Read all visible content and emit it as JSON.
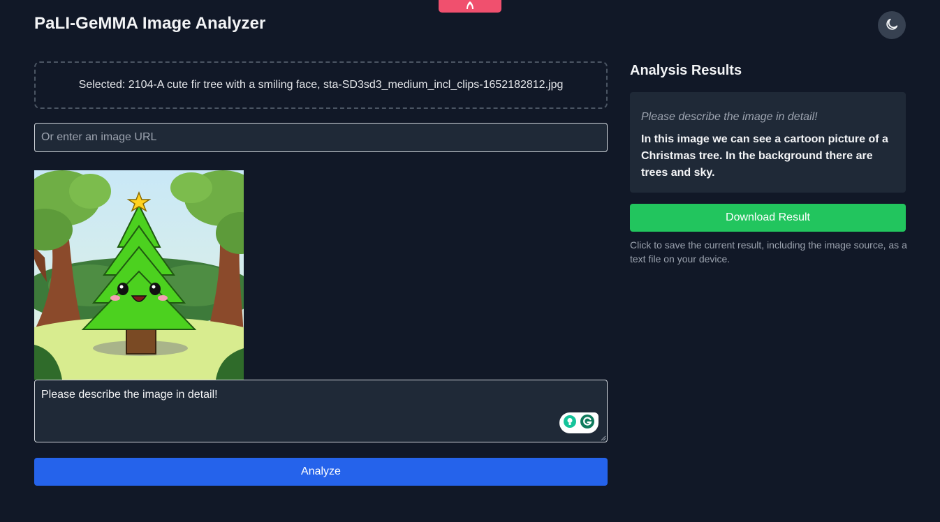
{
  "app": {
    "title": "PaLI-GeMMA Image Analyzer"
  },
  "icons": {
    "theme_toggle": "moon-icon",
    "top_tab": "flame-icon",
    "grammarly": "grammarly-icon"
  },
  "upload": {
    "selected_text": "Selected: 2104-A cute fir tree with a smiling face, sta-SD3sd3_medium_incl_clips-1652182812.jpg"
  },
  "url_input": {
    "placeholder": "Or enter an image URL",
    "value": ""
  },
  "prompt": {
    "value": "Please describe the image in detail!"
  },
  "buttons": {
    "analyze_label": "Analyze",
    "download_label": "Download Result"
  },
  "results": {
    "heading": "Analysis Results",
    "prompt": "Please describe the image in detail!",
    "answer": "In this image we can see a cartoon picture of a Christmas tree. In the background there are trees and sky.",
    "download_help": "Click to save the current result, including the image source, as a text file on your device."
  },
  "colors": {
    "background": "#111827",
    "card": "#1f2937",
    "analyze_button": "#2563eb",
    "download_button": "#22c55e",
    "top_tab": "#f0506e"
  }
}
